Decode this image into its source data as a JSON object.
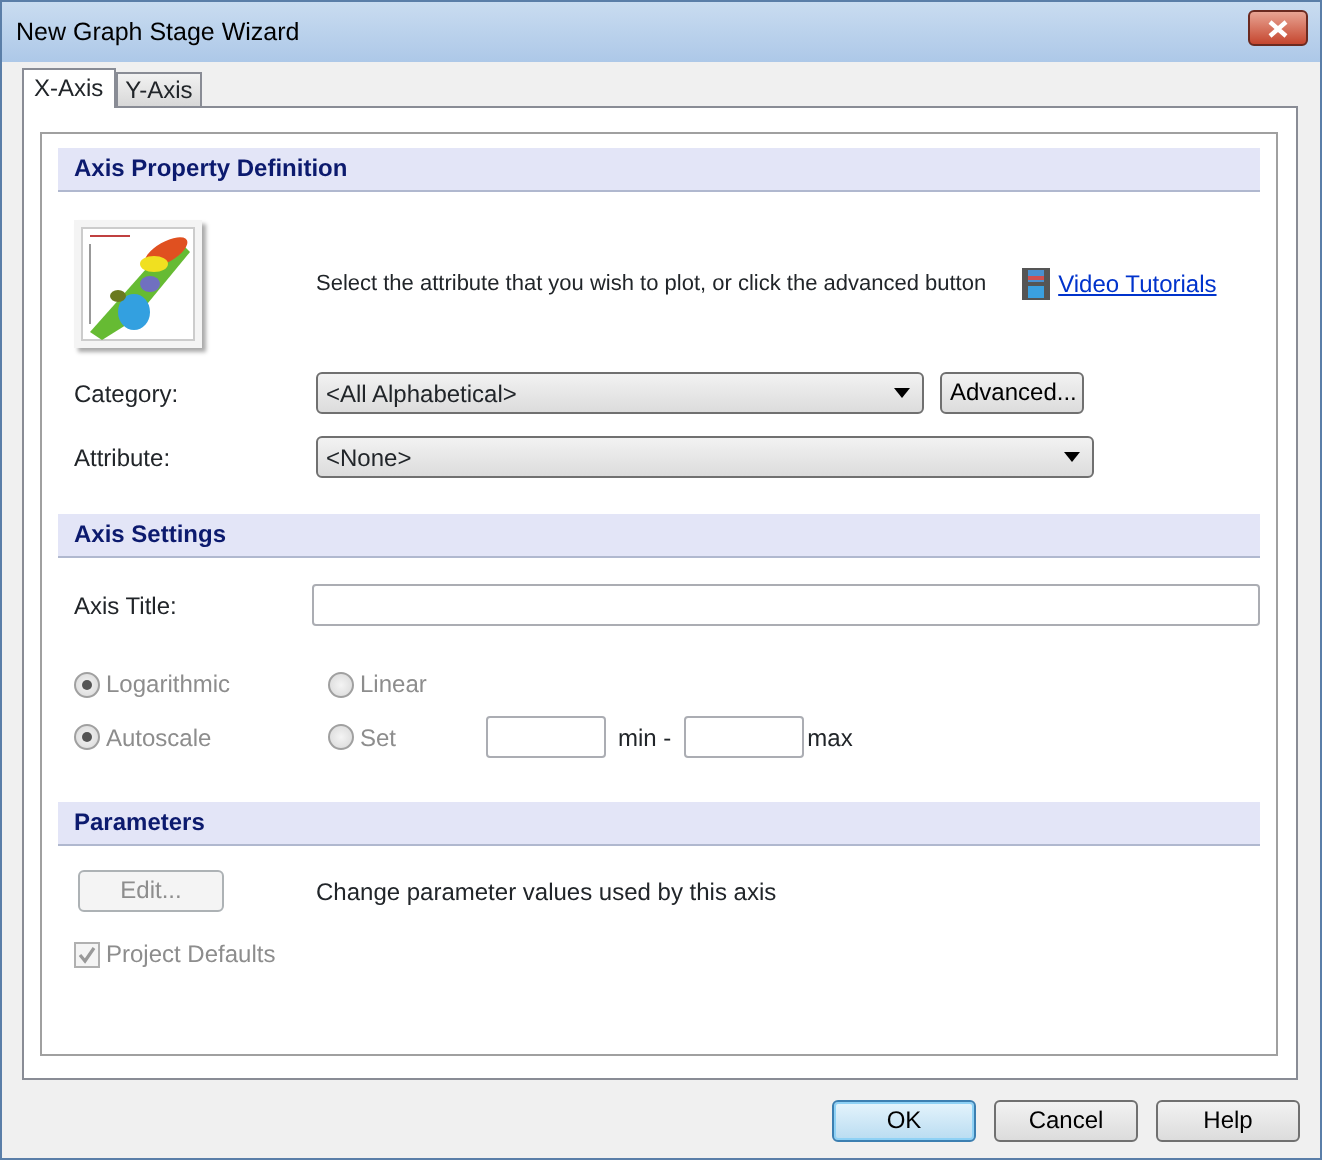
{
  "window": {
    "title": "New Graph Stage Wizard"
  },
  "tabs": [
    {
      "label": "X-Axis",
      "selected": true
    },
    {
      "label": "Y-Axis",
      "selected": false
    }
  ],
  "axis_property_definition": {
    "heading": "Axis Property Definition",
    "instruction": "Select the attribute that you wish to plot, or click the advanced button",
    "link": "Video Tutorials",
    "category": {
      "label": "Category:",
      "value": "<All Alphabetical>"
    },
    "advanced_button": "Advanced...",
    "attribute": {
      "label": "Attribute:",
      "value": "<None>"
    }
  },
  "axis_settings": {
    "heading": "Axis Settings",
    "axis_title": {
      "label": "Axis Title:"
    },
    "scale_radios": [
      {
        "label": "Logarithmic",
        "selected": true,
        "disabled": true
      },
      {
        "label": "Linear",
        "selected": false,
        "disabled": true
      }
    ],
    "range_radios": [
      {
        "label": "Autoscale",
        "selected": true,
        "disabled": true
      },
      {
        "label": "Set",
        "selected": false,
        "disabled": true
      }
    ],
    "min_label": "min -",
    "max_label": "max"
  },
  "parameters": {
    "heading": "Parameters",
    "edit_button": {
      "label": "Edit...",
      "disabled": true
    },
    "description": "Change parameter values used by this axis",
    "project_defaults": {
      "label": "Project Defaults",
      "checked": true,
      "disabled": true
    }
  },
  "buttons": [
    {
      "label": "OK",
      "default": true
    },
    {
      "label": "Cancel",
      "default": false
    },
    {
      "label": "Help",
      "default": false
    }
  ]
}
